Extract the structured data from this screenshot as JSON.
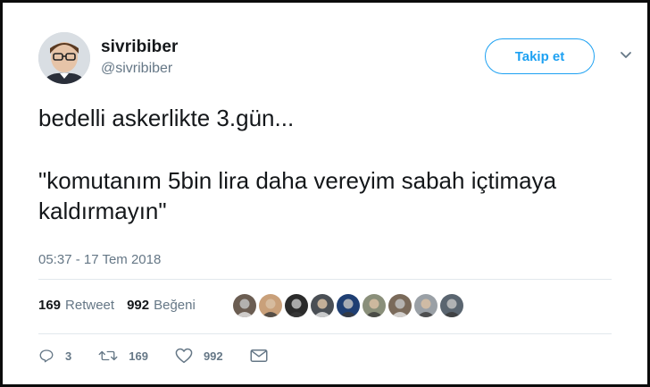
{
  "author": {
    "display_name": "sivribiber",
    "handle": "@sivribiber",
    "avatar_icon": "user-avatar-photo"
  },
  "follow_button": {
    "label": "Takip et",
    "accent": "#1da1f2"
  },
  "tweet": {
    "line1": "bedelli askerlikte 3.gün...",
    "line2": "\"komutanım 5bin lira daha vereyim sabah içtimaya kaldırmayın\"",
    "timestamp": "05:37 - 17 Tem 2018"
  },
  "stats": {
    "retweet_count": "169",
    "retweet_label": "Retweet",
    "like_count": "992",
    "like_label": "Beğeni"
  },
  "likers": [
    {
      "icon": "liker-avatar-1",
      "color": "#6b5d52"
    },
    {
      "icon": "liker-avatar-2",
      "color": "#c9a07a"
    },
    {
      "icon": "liker-avatar-3",
      "color": "#2b2b2b"
    },
    {
      "icon": "liker-avatar-4",
      "color": "#4a4f55"
    },
    {
      "icon": "liker-avatar-5",
      "color": "#1f3f73"
    },
    {
      "icon": "liker-avatar-6",
      "color": "#8a8f7a"
    },
    {
      "icon": "liker-avatar-7",
      "color": "#7a6a5a"
    },
    {
      "icon": "liker-avatar-8",
      "color": "#9aa0a6"
    },
    {
      "icon": "liker-avatar-9",
      "color": "#5a6570"
    }
  ],
  "actions": {
    "reply_count": "3",
    "retweet_count": "169",
    "like_count": "992"
  },
  "colors": {
    "text": "#14171a",
    "muted": "#657786",
    "divider": "#e1e8ed",
    "frame": "#0b0b0b"
  }
}
